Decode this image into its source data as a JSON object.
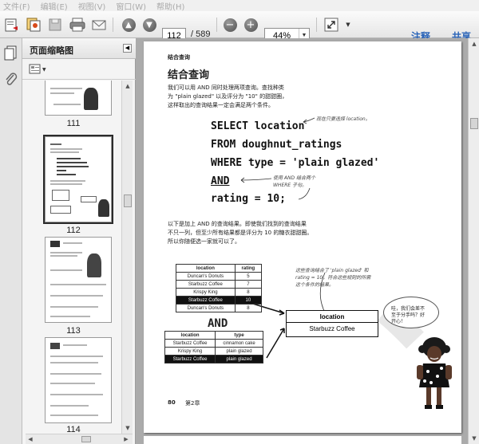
{
  "menu": [
    "文件(F)",
    "编辑(E)",
    "视图(V)",
    "窗口(W)",
    "帮助(H)"
  ],
  "toolbar": {
    "current_page": "112",
    "page_total": "/ 589",
    "zoom": "44%",
    "annotate_label": "注释",
    "share_label": "共享"
  },
  "panel": {
    "title": "页面缩略图",
    "thumbnails": [
      {
        "label": "111",
        "selected": false
      },
      {
        "label": "112",
        "selected": true
      },
      {
        "label": "113",
        "selected": false
      },
      {
        "label": "114",
        "selected": false
      }
    ]
  },
  "doc": {
    "chapter_tag": "结合查询",
    "heading": "结合查询",
    "intro": [
      "我们可以用 AND 同时处理两项查询。查找种类",
      "为 \"plain glazed\" 以及评分为 \"10\" 的甜甜圈，",
      "这样取出的查询结果一定会满足两个条件。"
    ],
    "code": [
      "SELECT location",
      "FROM doughnut_ratings",
      "WHERE type = 'plain glazed'",
      "AND",
      "rating = 10;"
    ],
    "note_select": "现在只要选择 location。",
    "note_and": [
      "使用 AND 结合两个",
      "WHERE 子句。"
    ],
    "body": [
      "以下是加上 AND 的查询结果。即使我们找到的查询结果",
      "不只一列，但至少所有结果都是评分为 10 的糖衣甜甜圈。",
      "所以你随便选一家就可以了。"
    ],
    "table1": {
      "headers": [
        "location",
        "rating"
      ],
      "rows": [
        [
          "Duncan's Donuts",
          "5"
        ],
        [
          "Starbuzz Coffee",
          "7"
        ],
        [
          "Krispy King",
          "8"
        ],
        [
          "Starbuzz Coffee",
          "10"
        ],
        [
          "Duncan's Donuts",
          "8"
        ]
      ]
    },
    "and_label": "AND",
    "table2": {
      "headers": [
        "location",
        "type"
      ],
      "rows": [
        [
          "Starbuzz Coffee",
          "cinnamon cake"
        ],
        [
          "Krispy King",
          "plain glazed"
        ],
        [
          "Starbuzz Coffee",
          "plain glazed"
        ]
      ]
    },
    "note_result": [
      "这些查询结合了 'plain glazed' 和",
      "rating = 10，符合这些规则的所需",
      "这个条件的结果。"
    ],
    "result_table": {
      "header": "location",
      "value": "Starbuzz Coffee"
    },
    "bubble": [
      "哇，我们会差不",
      "至于分手吗？好",
      "开心！"
    ],
    "footer_page": "80",
    "footer_chapter": "第2章"
  }
}
